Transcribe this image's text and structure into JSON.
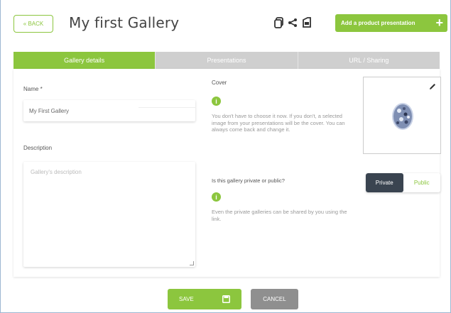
{
  "header": {
    "back_label": "« BACK",
    "title": "My first Gallery",
    "add_button_label": "Add a product presentation",
    "icons": [
      "copy-icon",
      "share-icon",
      "export-icon",
      "plus-icon"
    ]
  },
  "tabs": [
    {
      "label": "Gallery details",
      "active": true
    },
    {
      "label": "Presentations",
      "active": false
    },
    {
      "label": "URL / Sharing",
      "active": false
    }
  ],
  "form": {
    "name_label": "Name *",
    "name_value": "My First Gallery",
    "description_label": "Description",
    "description_placeholder": "Gallery's description"
  },
  "cover": {
    "label": "Cover",
    "help": "You don't have to choose it now. If you don't, a selected image from your presentations will be the cover. You can always come back and change it."
  },
  "privacy": {
    "question": "Is this gallery private or public?",
    "help": "Even the private galleries can be shared by you using the link.",
    "options": [
      "Private",
      "Public"
    ],
    "selected": "Private"
  },
  "footer": {
    "save_label": "SAVE",
    "cancel_label": "CANCEL"
  },
  "colors": {
    "accent": "#8cc63e",
    "dark": "#3a4450",
    "tab_inactive": "#cfcfcf",
    "cancel": "#8f8f8f"
  }
}
